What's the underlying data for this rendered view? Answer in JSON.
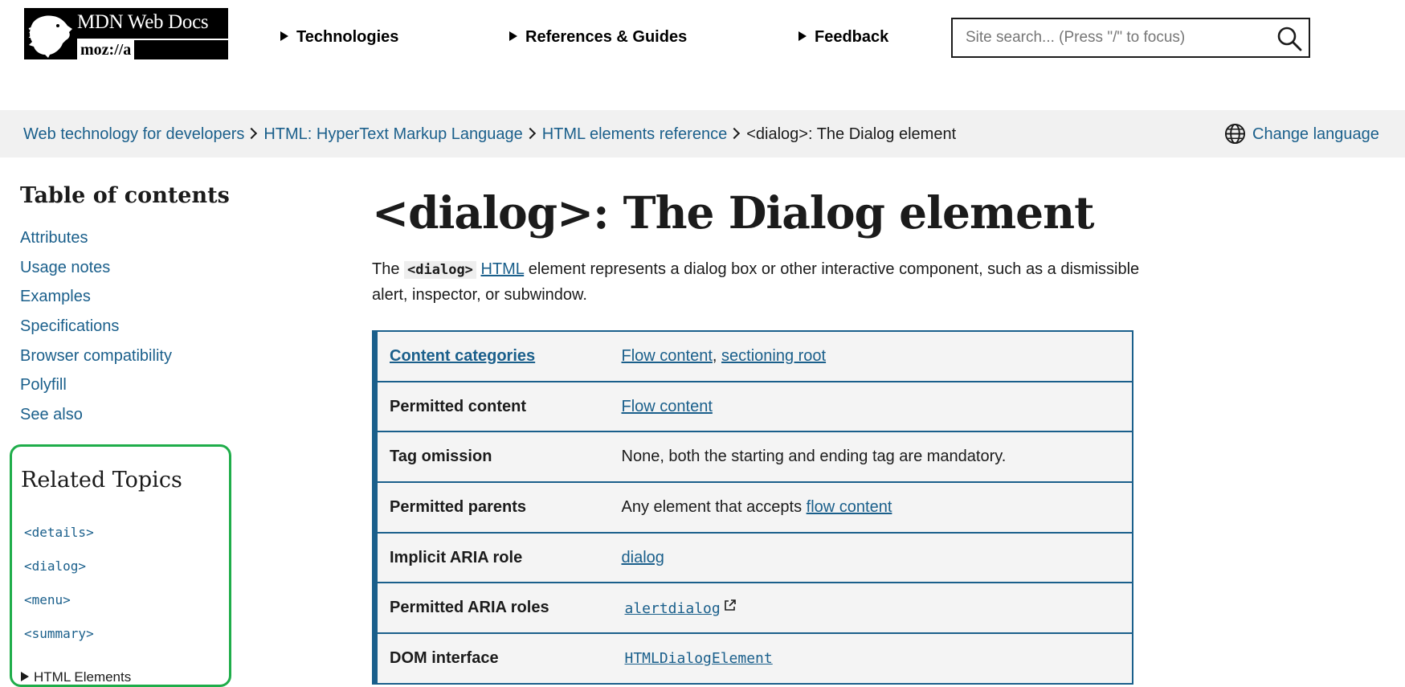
{
  "header": {
    "logo": {
      "title": "MDN Web Docs",
      "sub": "moz://a"
    },
    "nav": [
      "Technologies",
      "References & Guides",
      "Feedback"
    ],
    "search": {
      "placeholder": "Site search... (Press \"/\" to focus)",
      "value": ""
    }
  },
  "breadcrumbs": {
    "items": [
      "Web technology for developers",
      "HTML: HyperText Markup Language",
      "HTML elements reference"
    ],
    "current": "<dialog>: The Dialog element",
    "change_language": "Change language"
  },
  "sidebar": {
    "toc_title": "Table of contents",
    "toc": [
      "Attributes",
      "Usage notes",
      "Examples",
      "Specifications",
      "Browser compatibility",
      "Polyfill",
      "See also"
    ],
    "related_title": "Related Topics",
    "related": [
      "<details>",
      "<dialog>",
      "<menu>",
      "<summary>"
    ],
    "group_label": "HTML Elements",
    "highlight_color": "#1fad4a"
  },
  "main": {
    "title": "<dialog>: The Dialog element",
    "intro": {
      "before": "The ",
      "code": "<dialog>",
      "link": "HTML",
      "after": " element represents a dialog box or other interactive component, such as a dismissible alert, inspector, or subwindow."
    },
    "props": {
      "content_categories": {
        "key": "Content categories",
        "v1": "Flow content",
        "sep": ", ",
        "v2": "sectioning root"
      },
      "permitted_content": {
        "key": "Permitted content",
        "v": "Flow content"
      },
      "tag_omission": {
        "key": "Tag omission",
        "v": "None, both the starting and ending tag are mandatory."
      },
      "permitted_parents": {
        "key": "Permitted parents",
        "text": "Any element that accepts ",
        "link": "flow content"
      },
      "implicit_aria_role": {
        "key": "Implicit ARIA role",
        "v": "dialog"
      },
      "permitted_aria_roles": {
        "key": "Permitted ARIA roles",
        "v": "alertdialog"
      },
      "dom_interface": {
        "key": "DOM interface",
        "v": "HTMLDialogElement"
      }
    }
  },
  "colors": {
    "link": "#1a5f8b",
    "text": "#1b1b1b",
    "crumb_bg": "#f1f1f1",
    "table_bg": "#f4f4f4"
  }
}
